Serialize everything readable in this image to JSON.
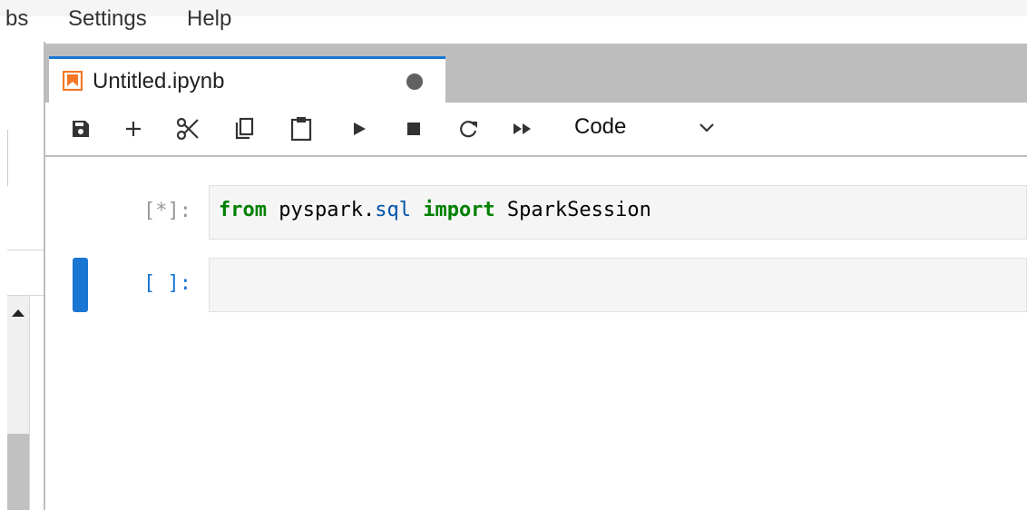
{
  "menu": {
    "items": [
      {
        "label": "bs"
      },
      {
        "label": "Settings"
      },
      {
        "label": "Help"
      }
    ]
  },
  "tab": {
    "title": "Untitled.ipynb",
    "icon": "notebook-icon",
    "accent_color": "#1976d2",
    "icon_color": "#f37626"
  },
  "toolbar": {
    "buttons": [
      "save-icon",
      "add-icon",
      "cut-icon",
      "copy-icon",
      "paste-icon",
      "run-icon",
      "stop-icon",
      "restart-icon",
      "fast-forward-icon"
    ],
    "cell_type": "Code"
  },
  "cells": [
    {
      "prompt": "[*]:",
      "code": {
        "kw1": "from",
        "text1": " pyspark.",
        "mod": "sql",
        "space": " ",
        "kw2": "import",
        "text2": " SparkSession"
      },
      "active": false
    },
    {
      "prompt": "[ ]:",
      "code": null,
      "active": true
    }
  ]
}
